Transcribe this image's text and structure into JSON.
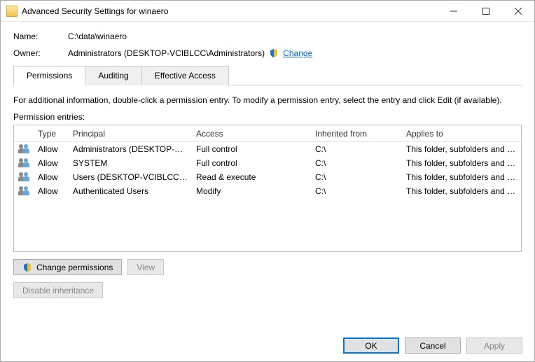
{
  "titlebar": {
    "title": "Advanced Security Settings for winaero"
  },
  "fields": {
    "name_label": "Name:",
    "name_value": "C:\\data\\winaero",
    "owner_label": "Owner:",
    "owner_value": "Administrators (DESKTOP-VCIBLCC\\Administrators)",
    "change_link": "Change"
  },
  "tabs": {
    "permissions": "Permissions",
    "auditing": "Auditing",
    "effective": "Effective Access"
  },
  "info_text": "For additional information, double-click a permission entry. To modify a permission entry, select the entry and click Edit (if available).",
  "section_label": "Permission entries:",
  "columns": {
    "type": "Type",
    "principal": "Principal",
    "access": "Access",
    "inherited": "Inherited from",
    "applies": "Applies to"
  },
  "entries": [
    {
      "type": "Allow",
      "principal": "Administrators (DESKTOP-VCI...",
      "access": "Full control",
      "inherited": "C:\\",
      "applies": "This folder, subfolders and files"
    },
    {
      "type": "Allow",
      "principal": "SYSTEM",
      "access": "Full control",
      "inherited": "C:\\",
      "applies": "This folder, subfolders and files"
    },
    {
      "type": "Allow",
      "principal": "Users (DESKTOP-VCIBLCC\\Us...",
      "access": "Read & execute",
      "inherited": "C:\\",
      "applies": "This folder, subfolders and files"
    },
    {
      "type": "Allow",
      "principal": "Authenticated Users",
      "access": "Modify",
      "inherited": "C:\\",
      "applies": "This folder, subfolders and files"
    }
  ],
  "buttons": {
    "change_permissions": "Change permissions",
    "view": "View",
    "disable_inheritance": "Disable inheritance",
    "ok": "OK",
    "cancel": "Cancel",
    "apply": "Apply"
  }
}
